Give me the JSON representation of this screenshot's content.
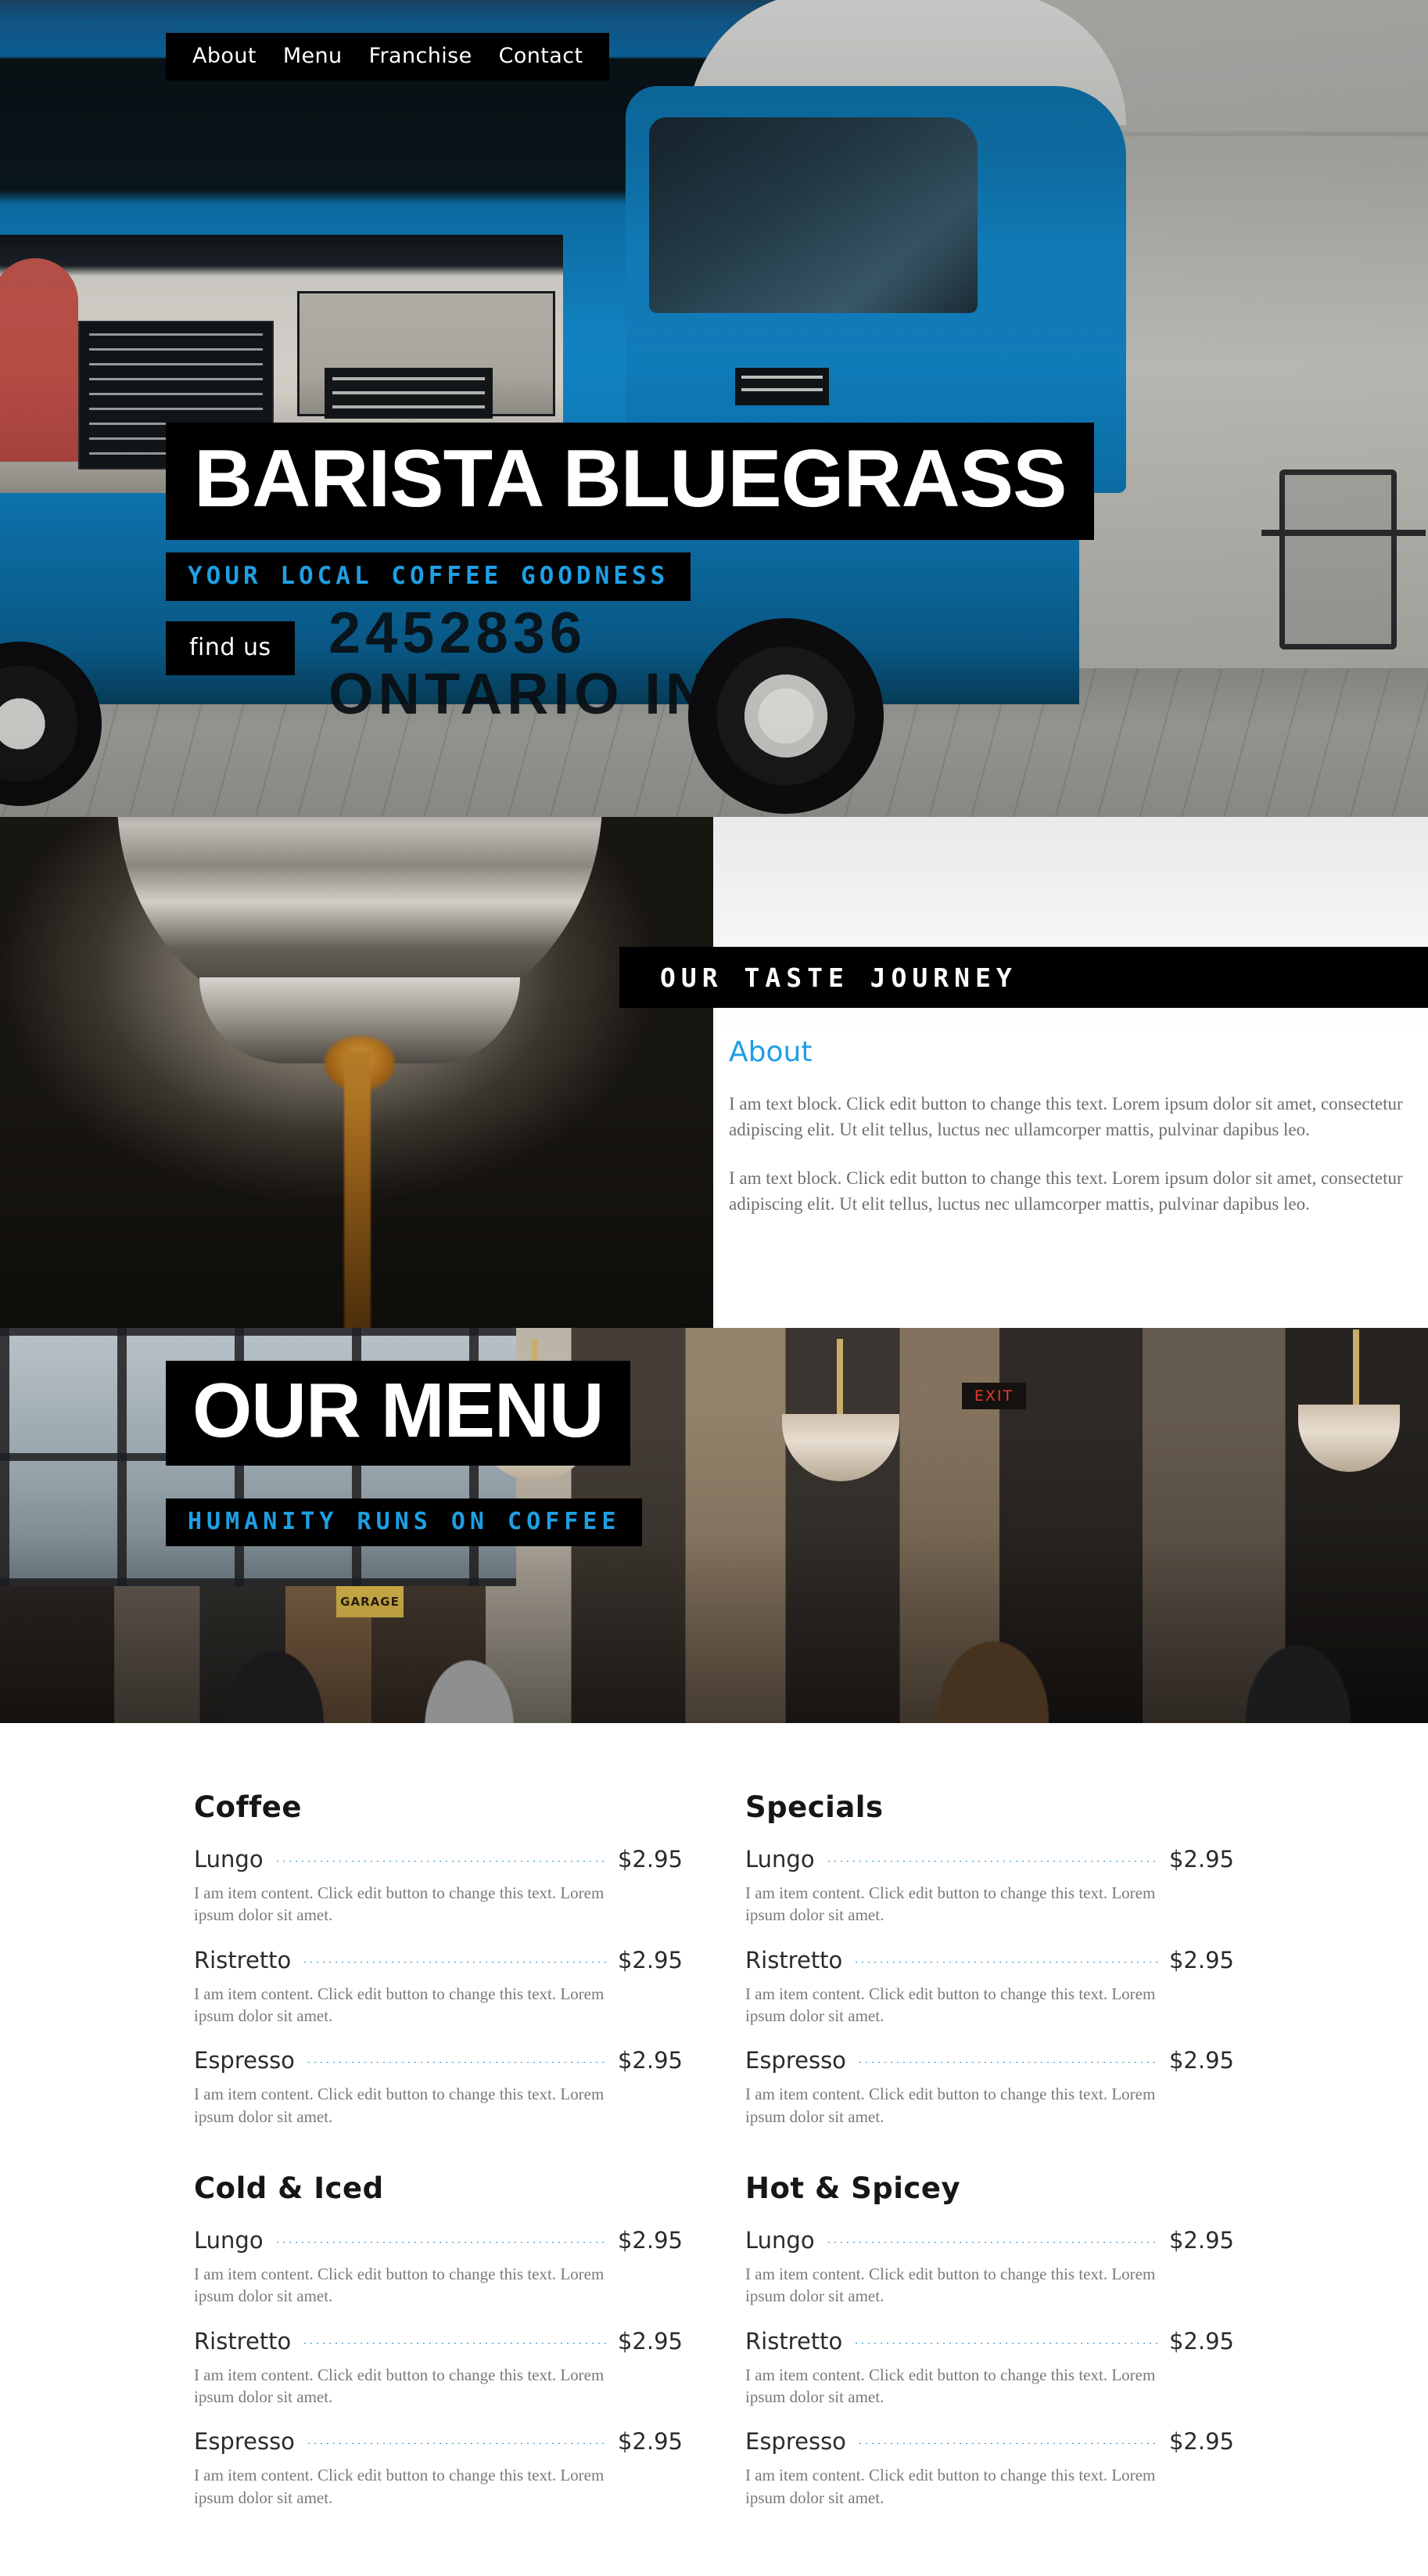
{
  "theme": {
    "accent_blue": "#1f9fe3",
    "black": "#000000",
    "white": "#ffffff",
    "body_text": "#6e6e70"
  },
  "nav": {
    "items": [
      {
        "label": "About"
      },
      {
        "label": "Menu"
      },
      {
        "label": "Franchise"
      },
      {
        "label": "Contact"
      }
    ]
  },
  "hero": {
    "title": "BARISTA BLUEGRASS",
    "subtitle": "YOUR LOCAL COFFEE GOODNESS",
    "button_label": "find us",
    "truck_text_line1": "2452836",
    "truck_text_line2": "ONTARIO INC."
  },
  "about": {
    "banner_title": "OUR TASTE JOURNEY",
    "heading": "About",
    "paragraphs": [
      "I am text block. Click edit button to change this text. Lorem ipsum dolor sit amet, consectetur adipiscing elit. Ut elit tellus, luctus nec ullamcorper mattis, pulvinar dapibus leo.",
      "I am text block. Click edit button to change this text. Lorem ipsum dolor sit amet, consectetur adipiscing elit. Ut elit tellus, luctus nec ullamcorper mattis, pulvinar dapibus leo."
    ]
  },
  "menu_banner": {
    "title": "OUR MENU",
    "subtitle": "HUMANITY RUNS ON COFFEE",
    "exit_sign": "EXIT",
    "garage_sign": "GARAGE"
  },
  "menu": {
    "categories": [
      {
        "title": "Coffee",
        "column": "left",
        "items": [
          {
            "name": "Lungo",
            "price": "$2.95",
            "desc": "I am item content. Click edit button to change this text. Lorem ipsum dolor sit amet."
          },
          {
            "name": "Ristretto",
            "price": "$2.95",
            "desc": "I am item content. Click edit button to change this text. Lorem ipsum dolor sit amet."
          },
          {
            "name": "Espresso",
            "price": "$2.95",
            "desc": "I am item content. Click edit button to change this text. Lorem ipsum dolor sit amet."
          }
        ]
      },
      {
        "title": "Cold & Iced",
        "column": "left",
        "items": [
          {
            "name": "Lungo",
            "price": "$2.95",
            "desc": "I am item content. Click edit button to change this text. Lorem ipsum dolor sit amet."
          },
          {
            "name": "Ristretto",
            "price": "$2.95",
            "desc": "I am item content. Click edit button to change this text. Lorem ipsum dolor sit amet."
          },
          {
            "name": "Espresso",
            "price": "$2.95",
            "desc": "I am item content. Click edit button to change this text. Lorem ipsum dolor sit amet."
          }
        ]
      },
      {
        "title": "Specials",
        "column": "right",
        "items": [
          {
            "name": "Lungo",
            "price": "$2.95",
            "desc": "I am item content. Click edit button to change this text. Lorem ipsum dolor sit amet."
          },
          {
            "name": "Ristretto",
            "price": "$2.95",
            "desc": "I am item content. Click edit button to change this text. Lorem ipsum dolor sit amet."
          },
          {
            "name": "Espresso",
            "price": "$2.95",
            "desc": "I am item content. Click edit button to change this text. Lorem ipsum dolor sit amet."
          }
        ]
      },
      {
        "title": "Hot & Spicey",
        "column": "right",
        "items": [
          {
            "name": "Lungo",
            "price": "$2.95",
            "desc": "I am item content. Click edit button to change this text. Lorem ipsum dolor sit amet."
          },
          {
            "name": "Ristretto",
            "price": "$2.95",
            "desc": "I am item content. Click edit button to change this text. Lorem ipsum dolor sit amet."
          },
          {
            "name": "Espresso",
            "price": "$2.95",
            "desc": "I am item content. Click edit button to change this text. Lorem ipsum dolor sit amet."
          }
        ]
      }
    ]
  }
}
